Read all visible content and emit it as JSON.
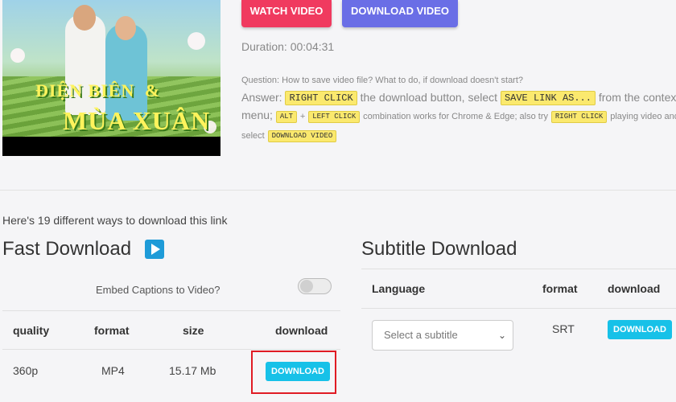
{
  "video": {
    "thumbnail_title_line1": "ĐIỆN BIÊN",
    "thumbnail_title_amp": "&",
    "thumbnail_title_line2": "MÙA XUÂN"
  },
  "actions": {
    "watch_label": "WATCH VIDEO",
    "download_label": "DOWNLOAD VIDEO"
  },
  "duration": "Duration: 00:04:31",
  "help": {
    "question": "Question: How to save video file? What to do, if download doesn't start?",
    "answer_prefix": "Answer:",
    "right_click": "RIGHT CLICK",
    "text_dl_button": "the download button, select",
    "save_link_as": "SAVE LINK AS...",
    "text_from_context": "from the context",
    "text_menu": "menu;",
    "alt": "ALT",
    "plus": "+",
    "left_click": "LEFT CLICK",
    "text_combination": "combination works for Chrome & Edge; also try",
    "right_click_small": "RIGHT CLICK",
    "text_playing": "playing video and",
    "text_select": "select",
    "download_video_small": "DOWNLOAD VIDEO"
  },
  "ways_text": "Here's 19 different ways to download this link",
  "fast_download": {
    "heading": "Fast Download",
    "embed_label": "Embed Captions to Video?",
    "embed_enabled": false,
    "columns": [
      "quality",
      "format",
      "size",
      "download"
    ],
    "rows": [
      {
        "quality": "360p",
        "format": "MP4",
        "size": "15.17 Mb",
        "button": "DOWNLOAD"
      }
    ]
  },
  "subtitle_download": {
    "heading": "Subtitle Download",
    "columns": [
      "Language",
      "format",
      "download"
    ],
    "select_placeholder": "Select a subtitle",
    "format": "SRT",
    "button": "DOWNLOAD"
  },
  "colors": {
    "watch": "#f03a5f",
    "download_video": "#6a6ee6",
    "download_btn": "#17c1e8",
    "highlight": "#e01b24"
  }
}
